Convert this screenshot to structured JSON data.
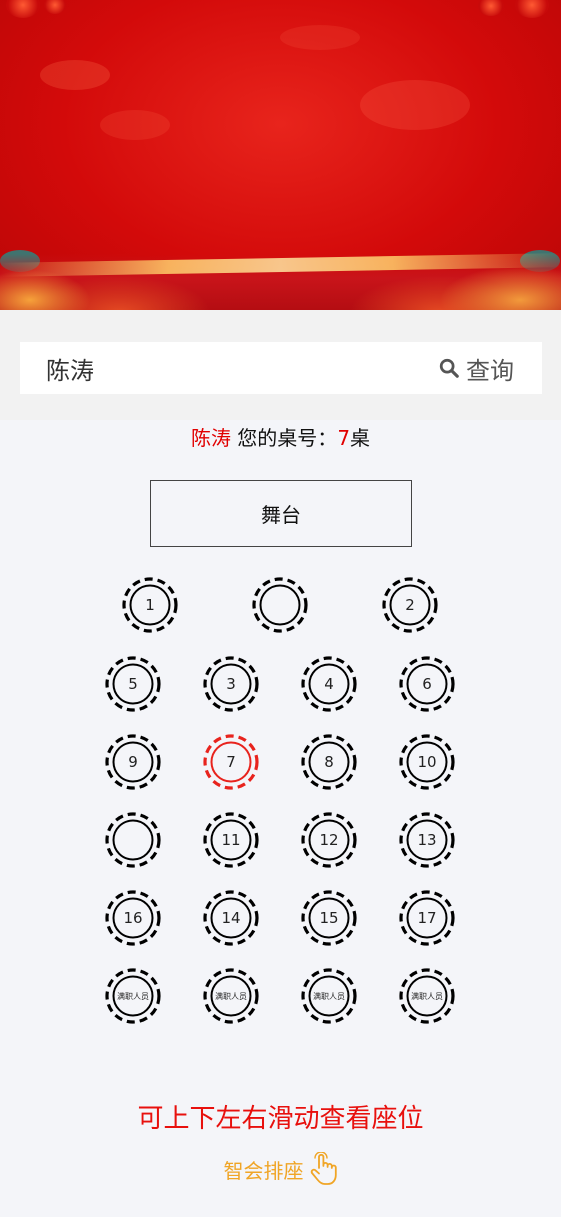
{
  "search": {
    "value": "陈涛",
    "button_label": "查询",
    "icon": "search-icon"
  },
  "result": {
    "name": "陈涛",
    "text": " 您的桌号：",
    "table": "7",
    "suffix": "桌"
  },
  "stage": {
    "label": "舞台"
  },
  "colors": {
    "highlight": "#e8231d",
    "normal": "#000000",
    "hint": "#e8100d",
    "brand": "#f0a526"
  },
  "tables": [
    {
      "label": "1",
      "active": false
    },
    {
      "label": "",
      "active": false
    },
    {
      "label": "2",
      "active": false
    },
    {
      "label": "5",
      "active": false
    },
    {
      "label": "3",
      "active": false
    },
    {
      "label": "4",
      "active": false
    },
    {
      "label": "6",
      "active": false
    },
    {
      "label": "9",
      "active": false
    },
    {
      "label": "7",
      "active": true
    },
    {
      "label": "8",
      "active": false
    },
    {
      "label": "10",
      "active": false
    },
    {
      "label": "",
      "active": false
    },
    {
      "label": "11",
      "active": false
    },
    {
      "label": "12",
      "active": false
    },
    {
      "label": "13",
      "active": false
    },
    {
      "label": "16",
      "active": false
    },
    {
      "label": "14",
      "active": false
    },
    {
      "label": "15",
      "active": false
    },
    {
      "label": "17",
      "active": false
    },
    {
      "label": "满职人员",
      "active": false
    },
    {
      "label": "满职人员",
      "active": false
    },
    {
      "label": "满职人员",
      "active": false
    },
    {
      "label": "满职人员",
      "active": false
    }
  ],
  "footer": {
    "hint": "可上下左右滑动查看座位",
    "brand": "智会排座",
    "brand_icon": "hand-pointer-icon"
  }
}
